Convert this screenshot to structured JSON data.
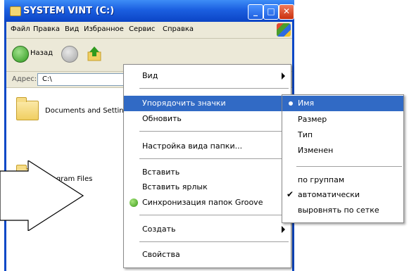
{
  "window": {
    "title": "SYSTEM VINT (C:)",
    "menubar": [
      "Файл",
      "Правка",
      "Вид",
      "Избранное",
      "Сервис",
      "Справка"
    ],
    "toolbar": {
      "back_label": "Назад"
    },
    "address": {
      "label": "Адрес:",
      "value": "C:\\"
    },
    "folders": [
      "Documents and Settings",
      "Program Files"
    ]
  },
  "context_menu": {
    "items": [
      {
        "label": "Вид"
      },
      {
        "label": "Упорядочить значки"
      },
      {
        "label": "Обновить"
      },
      {
        "label": "Настройка вида папки..."
      },
      {
        "label": "Вставить"
      },
      {
        "label": "Вставить ярлык"
      },
      {
        "label": "Синхронизация папок Groove"
      },
      {
        "label": "Создать"
      },
      {
        "label": "Свойства"
      }
    ],
    "highlighted": "Упорядочить значки"
  },
  "submenu": {
    "items": [
      {
        "label": "Имя"
      },
      {
        "label": "Размер"
      },
      {
        "label": "Тип"
      },
      {
        "label": "Изменен"
      },
      {
        "label": "по группам"
      },
      {
        "label": "автоматически"
      },
      {
        "label": "выровнять по сетке"
      }
    ],
    "highlighted": "Имя",
    "checked": "автоматически"
  },
  "colors": {
    "highlight": "#316ac5",
    "titlebar": "#1b5fe0"
  }
}
